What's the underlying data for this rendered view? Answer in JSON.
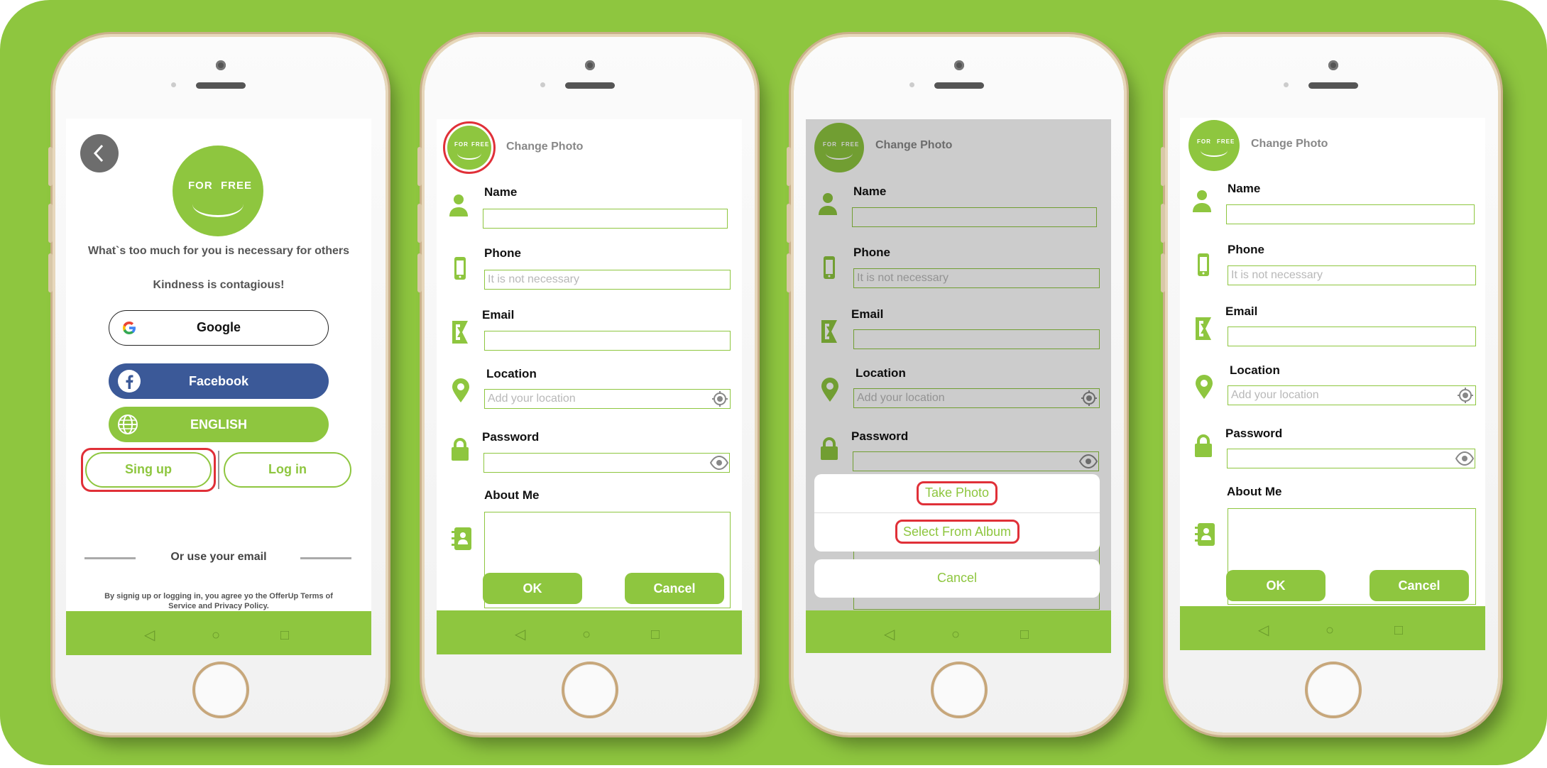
{
  "colors": {
    "brand_green": "#8ec63f",
    "facebook_blue": "#3b5998",
    "highlight_red": "#e03038",
    "background": "#8ec63f"
  },
  "logo": {
    "left": "FOR",
    "right": "FREE"
  },
  "screen1": {
    "tagline": "What`s too much for you is necessary for others",
    "subtitle": "Kindness is contagious!",
    "google_label": "Google",
    "facebook_label": "Facebook",
    "language_label": "ENGLISH",
    "signup_label": "Sing up",
    "login_label": "Log in",
    "or_email": "Or use your email",
    "terms": "By signig up or logging in, you agree yo the OfferUp Terms of Service and Privacy Policy."
  },
  "form": {
    "change_photo": "Change Photo",
    "name_label": "Name",
    "phone_label": "Phone",
    "phone_placeholder": "It is not necessary",
    "email_label": "Email",
    "location_label": "Location",
    "location_placeholder": "Add your location",
    "password_label": "Password",
    "about_label": "About Me",
    "ok_label": "OK",
    "cancel_label": "Cancel"
  },
  "action_sheet": {
    "take_photo": "Take Photo",
    "select_album": "Select From Album",
    "cancel": "Cancel"
  },
  "icons": [
    "back-arrow-icon",
    "google-icon",
    "facebook-icon",
    "globe-icon",
    "person-icon",
    "phone-icon",
    "email-icon",
    "location-pin-icon",
    "lock-icon",
    "contacts-icon",
    "gps-target-icon",
    "eye-icon",
    "nav-back-icon",
    "nav-home-icon",
    "nav-recent-icon"
  ]
}
